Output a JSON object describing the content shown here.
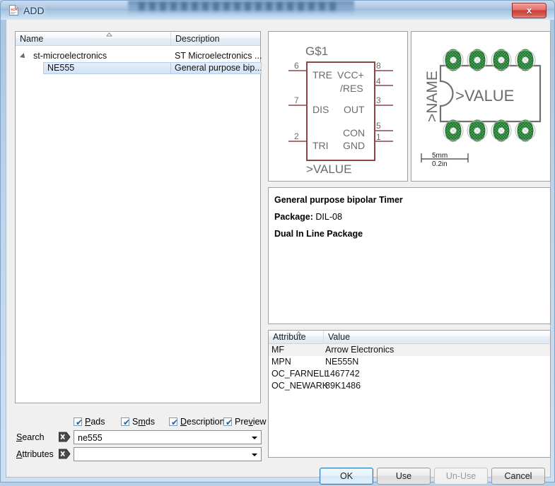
{
  "window": {
    "title": "ADD",
    "icon": "sch-document-icon",
    "close_label": "x"
  },
  "tree": {
    "columns": [
      "Name",
      "Description"
    ],
    "rows": [
      {
        "name": "st-microelectronics",
        "description": "ST Microelectronics ...",
        "level": 0,
        "expandable": true,
        "selected": false
      },
      {
        "name": "NE555",
        "description": "General purpose bip...",
        "level": 1,
        "expandable": false,
        "selected": true
      }
    ]
  },
  "symbol_preview": {
    "device_name": "G$1",
    "value_label": ">VALUE",
    "pins_left": [
      {
        "number": "6",
        "label": "TRE"
      },
      {
        "number": "7",
        "label": "DIS"
      },
      {
        "number": "2",
        "label": "TRI"
      }
    ],
    "pins_right": [
      {
        "number": "8",
        "label": "VCC+"
      },
      {
        "number": "4",
        "label": "/RES"
      },
      {
        "number": "3",
        "label": "OUT"
      },
      {
        "number": "5",
        "label": "CON"
      },
      {
        "number": "1",
        "label": "GND"
      }
    ],
    "outline_color": "#8c4646",
    "text_color": "#6b6b6b"
  },
  "package_preview": {
    "name_label": ">NAME",
    "value_label": ">VALUE",
    "pad_count": 8,
    "pad_color": "#2e8b3d",
    "outline_color": "#707070",
    "scale_mm": "5mm",
    "scale_in": "0.2in"
  },
  "description": {
    "heading": "General purpose bipolar Timer",
    "package_label": "Package:",
    "package_value": "DIL-08",
    "package_desc": "Dual In Line Package"
  },
  "attributes": {
    "columns": [
      "Attribute",
      "Value"
    ],
    "rows": [
      {
        "key": "MF",
        "value": "Arrow Electronics"
      },
      {
        "key": "MPN",
        "value": "NE555N"
      },
      {
        "key": "OC_FARNELL",
        "value": "1467742"
      },
      {
        "key": "OC_NEWARK",
        "value": "89K1486"
      }
    ]
  },
  "checkboxes": [
    {
      "label": "Pads",
      "mnemonic": "P",
      "checked": true
    },
    {
      "label": "Smds",
      "mnemonic": "m",
      "checked": true
    },
    {
      "label": "Description",
      "mnemonic": "D",
      "checked": true
    },
    {
      "label": "Preview",
      "mnemonic": "v",
      "checked": true
    }
  ],
  "search": {
    "label": "Search",
    "mnemonic": "S",
    "value": "ne555",
    "placeholder": "",
    "clear_icon": "clear-x-icon"
  },
  "attributes_filter": {
    "label": "Attributes",
    "mnemonic": "A",
    "value": "",
    "placeholder": "",
    "clear_icon": "clear-x-icon"
  },
  "buttons": {
    "ok": "OK",
    "use": "Use",
    "unuse": "Un-Use",
    "cancel": "Cancel"
  }
}
